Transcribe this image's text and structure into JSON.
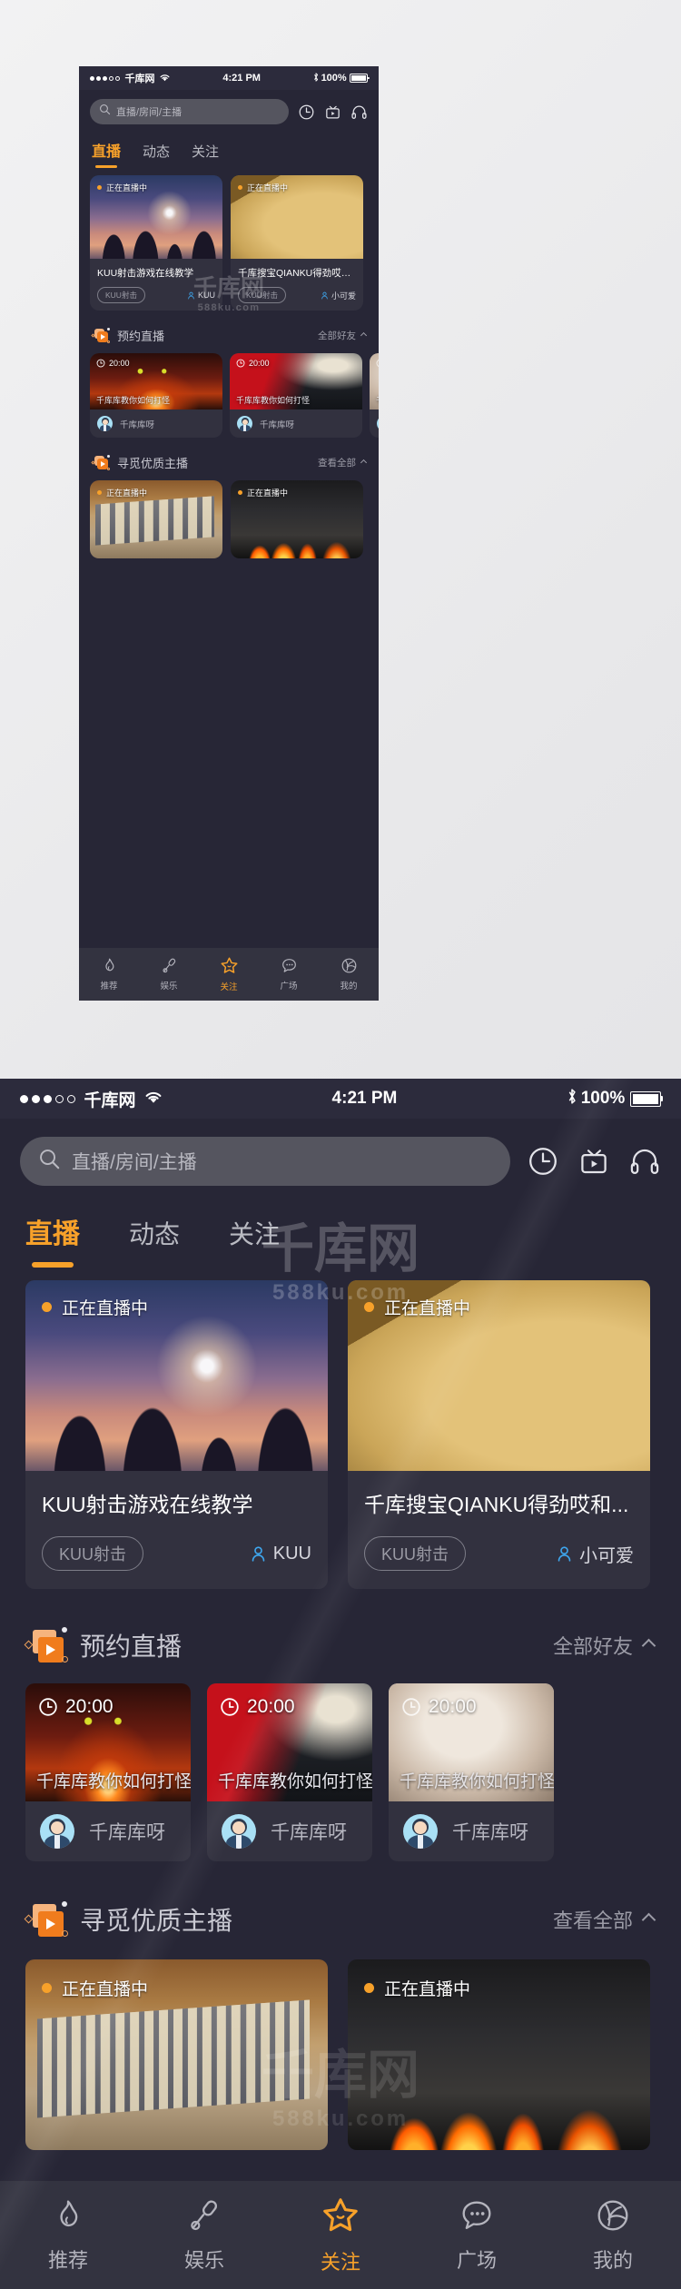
{
  "status_bar": {
    "signal_dots_filled": 3,
    "signal_dots_total": 5,
    "carrier": "千库网",
    "time": "4:21 PM",
    "battery_text": "100%"
  },
  "search": {
    "placeholder": "直播/房间/主播",
    "icons": [
      "search-icon",
      "clock-icon",
      "tv-play-icon",
      "headphones-icon"
    ]
  },
  "tabs": [
    {
      "label": "直播",
      "active": true
    },
    {
      "label": "动态",
      "active": false
    },
    {
      "label": "关注",
      "active": false
    }
  ],
  "live_cards": [
    {
      "badge": "正在直播中",
      "title": "KUU射击游戏在线教学",
      "tag": "KUU射击",
      "owner": "KUU"
    },
    {
      "badge": "正在直播中",
      "title": "千库搜宝QIANKU得劲哎和...",
      "tag": "KUU射击",
      "owner": "小可爱"
    }
  ],
  "sections": [
    {
      "title": "预约直播",
      "more": "全部好友",
      "cards": [
        {
          "time": "20:00",
          "overlay": "千库库教你如何打怪",
          "name": "千库库呀"
        },
        {
          "time": "20:00",
          "overlay": "千库库教你如何打怪",
          "name": "千库库呀"
        },
        {
          "time": "20:00",
          "overlay": "千库库教你如何打怪",
          "name": "千库库呀"
        }
      ]
    },
    {
      "title": "寻觅优质主播",
      "more": "查看全部",
      "cards": [
        {
          "badge": "正在直播中"
        },
        {
          "badge": "正在直播中"
        }
      ]
    }
  ],
  "bottom_nav": [
    {
      "label": "推荐",
      "icon": "flame-icon",
      "active": false
    },
    {
      "label": "娱乐",
      "icon": "microphone-icon",
      "active": false
    },
    {
      "label": "关注",
      "icon": "star-icon",
      "active": true
    },
    {
      "label": "广场",
      "icon": "chat-bubble-icon",
      "active": false
    },
    {
      "label": "我的",
      "icon": "ball-icon",
      "active": false
    }
  ],
  "watermark": {
    "brand": "千库网",
    "site": "588ku.com"
  },
  "colors": {
    "accent": "#f7a12a",
    "app_background": "#272636",
    "card_background": "#32313f",
    "status_bar": "#2c2b3c",
    "nav_background": "#333340"
  }
}
